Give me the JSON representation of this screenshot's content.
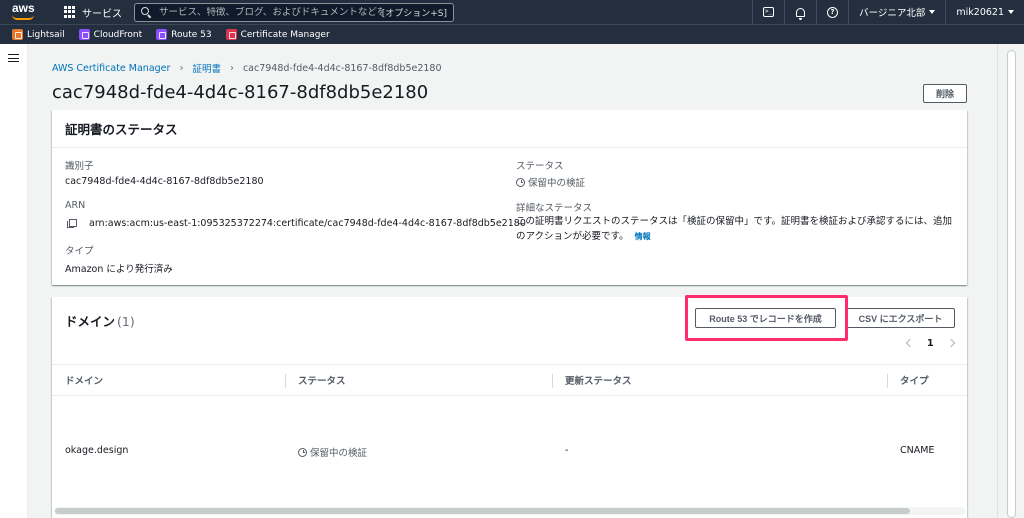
{
  "topnav": {
    "logo_text": "aws",
    "services_label": "サービス",
    "search_placeholder": "サービス、特徴、ブログ、およびドキュメントなどを検索",
    "search_shortcut": "[オプション+S]",
    "cloudshell_glyph": ">_",
    "help_glyph": "?",
    "region": "バージニア北部",
    "account": "mik20621"
  },
  "favorites": [
    {
      "label": "Lightsail",
      "color": "#e7772a"
    },
    {
      "label": "CloudFront",
      "color": "#8c4fff"
    },
    {
      "label": "Route 53",
      "color": "#8c4fff"
    },
    {
      "label": "Certificate Manager",
      "color": "#dd344c"
    }
  ],
  "breadcrumb": {
    "root": "AWS Certificate Manager",
    "section": "証明書",
    "current": "cac7948d-fde4-4d4c-8167-8df8db5e2180"
  },
  "page": {
    "title": "cac7948d-fde4-4d4c-8167-8df8db5e2180",
    "delete_label": "削除"
  },
  "status_panel": {
    "header": "証明書のステータス",
    "identifier_label": "識別子",
    "identifier_value": "cac7948d-fde4-4d4c-8167-8df8db5e2180",
    "arn_label": "ARN",
    "arn_value": "arn:aws:acm:us-east-1:095325372274:certificate/cac7948d-fde4-4d4c-8167-8df8db5e2180",
    "type_label": "タイプ",
    "type_value": "Amazon により発行済み",
    "status_label": "ステータス",
    "status_value": "保留中の検証",
    "detail_label": "詳細なステータス",
    "detail_value": "この証明書リクエストのステータスは「検証の保留中」です。証明書を検証および承認するには、追加のアクションが必要です。",
    "info_link": "情報"
  },
  "domain_panel": {
    "title": "ドメイン",
    "count": "(1)",
    "route53_button": "Route 53 でレコードを作成",
    "csv_button": "CSV にエクスポート",
    "page_number": "1",
    "columns": [
      "ドメイン",
      "ステータス",
      "更新ステータス",
      "タイプ"
    ],
    "rows": [
      {
        "domain": "okage.design",
        "status": "保留中の検証",
        "renewal": "-",
        "type": "CNAME"
      }
    ]
  },
  "colors": {
    "nav_bg": "#232f3e",
    "link": "#0073bb",
    "highlight": "#ff2d6b",
    "aws_orange": "#ff9900"
  }
}
